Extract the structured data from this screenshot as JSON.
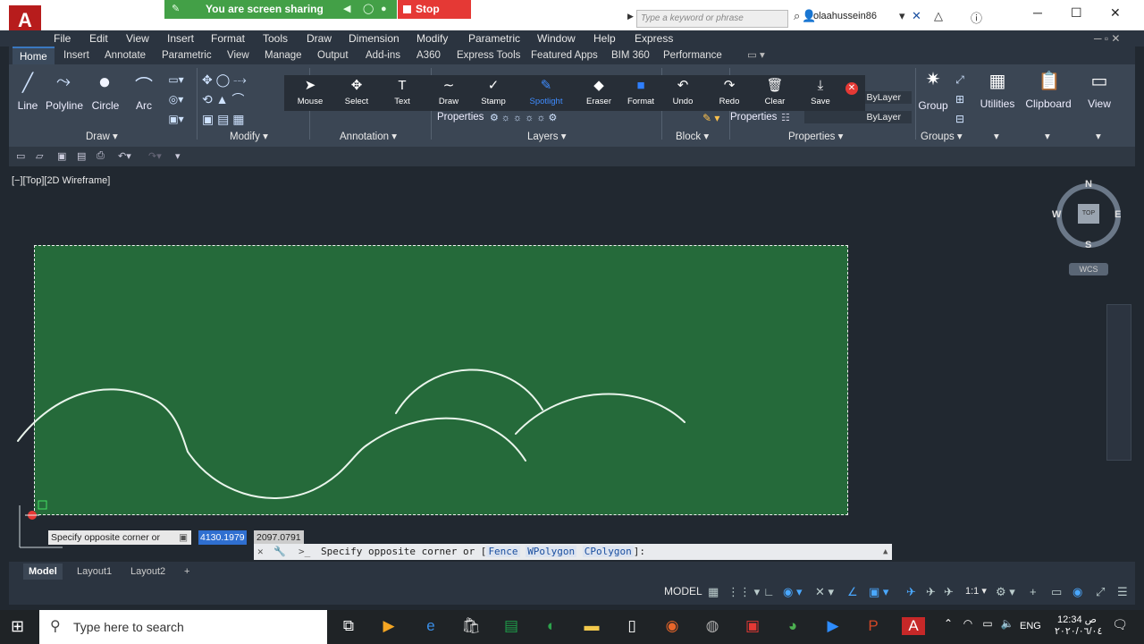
{
  "title_bar": {
    "app_logo": "A",
    "share_banner": "You are screen sharing",
    "stop_share": "Stop Share",
    "search_placeholder": "Type a keyword or phrase",
    "user": "olaahussein86"
  },
  "menu": [
    "File",
    "Edit",
    "View",
    "Insert",
    "Format",
    "Tools",
    "Draw",
    "Dimension",
    "Modify",
    "Parametric",
    "Window",
    "Help",
    "Express"
  ],
  "ribbon_tabs": [
    "Home",
    "Insert",
    "Annotate",
    "Parametric",
    "View",
    "Manage",
    "Output",
    "Add-ins",
    "A360",
    "Express Tools",
    "Featured Apps",
    "BIM 360",
    "Performance"
  ],
  "ribbon": {
    "draw_tools": [
      "Line",
      "Polyline",
      "Circle",
      "Arc"
    ],
    "panels": [
      "Draw",
      "Modify",
      "Annotation",
      "Layers",
      "Block",
      "Properties",
      "Groups"
    ],
    "properties_label": "Properties",
    "bylayer_1": "ByLayer",
    "bylayer_2": "ByLayer",
    "group_label": "Group",
    "right_tools": [
      "Utilities",
      "Clipboard",
      "View"
    ]
  },
  "floating_toolbar": [
    "Mouse",
    "Select",
    "Text",
    "Draw",
    "Stamp",
    "Spotlight",
    "Eraser",
    "Format",
    "Undo",
    "Redo",
    "Clear",
    "Save"
  ],
  "viewport": {
    "label": "[−][Top][2D Wireframe]",
    "compass": {
      "n": "N",
      "s": "S",
      "e": "E",
      "w": "W",
      "top": "TOP"
    },
    "wcs": "WCS"
  },
  "command": {
    "tooltip": "Specify opposite corner or",
    "coord_x": "4130.1979",
    "coord_y": "2097.0791",
    "prompt": "Specify opposite corner or [",
    "opt1": "Fence",
    "opt2": "WPolygon",
    "opt3": "CPolygon",
    "prompt_end": "]:"
  },
  "layout_tabs": [
    "Model",
    "Layout1",
    "Layout2"
  ],
  "status": {
    "model": "MODEL",
    "scale": "1:1"
  },
  "taskbar": {
    "search_placeholder": "Type here to search",
    "lang": "ENG",
    "time": "12:34 ص",
    "date": "٢٠٢٠/٠٦/٠٤"
  }
}
